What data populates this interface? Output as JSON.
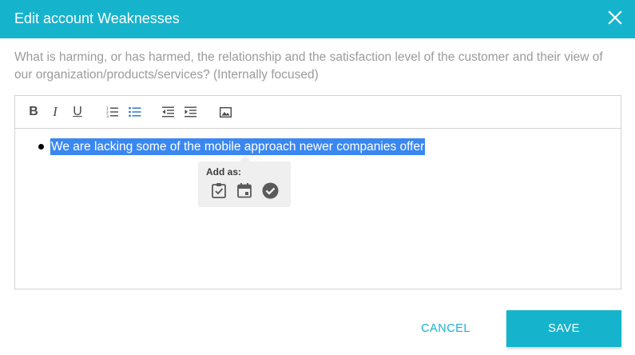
{
  "dialog": {
    "title": "Edit account Weaknesses",
    "close_icon": "close-icon"
  },
  "description": "What is harming, or has harmed, the relationship and the satisfaction level of the customer and their view of our organization/products/services? (Internally focused)",
  "toolbar": {
    "bold_label": "B",
    "italic_label": "I",
    "underline_label": "U",
    "icons": [
      "bold-icon",
      "italic-icon",
      "underline-icon",
      "numbered-list-icon",
      "bulleted-list-icon",
      "outdent-icon",
      "indent-icon",
      "image-icon"
    ],
    "active_color": "#1a73c8"
  },
  "editor": {
    "bullet_items": [
      "We are lacking some of the mobile approach newer companies offer"
    ],
    "selection_color": "#3a87f0"
  },
  "popover": {
    "label": "Add as:",
    "icons": [
      "clipboard-check-icon",
      "calendar-icon",
      "check-circle-icon"
    ]
  },
  "footer": {
    "cancel_label": "CANCEL",
    "save_label": "SAVE"
  },
  "colors": {
    "accent": "#16b3cd"
  }
}
